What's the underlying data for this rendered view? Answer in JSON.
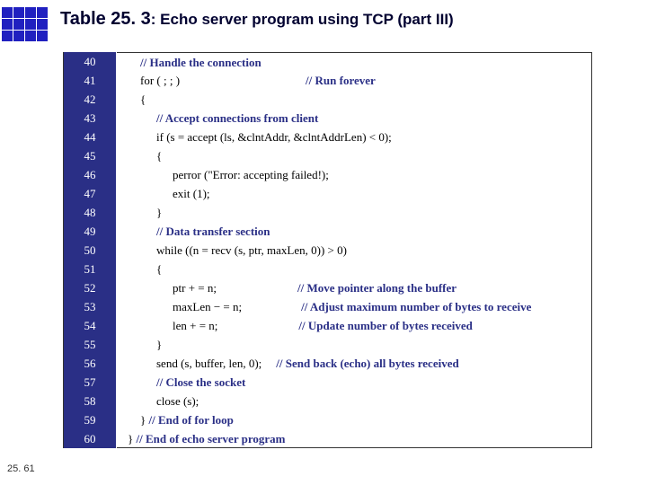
{
  "title": {
    "main": "Table 25. 3",
    "sub": ": Echo server program using TCP (part III)"
  },
  "slideNumber": "25. 61",
  "rows": [
    {
      "n": "40",
      "indent": 18,
      "code": "",
      "comment": "// Handle the connection"
    },
    {
      "n": "41",
      "indent": 18,
      "code": "for ( ; ; )",
      "gap": 140,
      "comment": "// Run forever"
    },
    {
      "n": "42",
      "indent": 18,
      "code": "{",
      "comment": ""
    },
    {
      "n": "43",
      "indent": 36,
      "code": "",
      "comment": "// Accept connections from client"
    },
    {
      "n": "44",
      "indent": 36,
      "code": "if (s = accept (ls, &clntAddr, &clntAddrLen) < 0);",
      "comment": ""
    },
    {
      "n": "45",
      "indent": 36,
      "code": "{",
      "comment": ""
    },
    {
      "n": "46",
      "indent": 54,
      "code": "perror (\"Error: accepting failed!);",
      "comment": ""
    },
    {
      "n": "47",
      "indent": 54,
      "code": "exit (1);",
      "comment": ""
    },
    {
      "n": "48",
      "indent": 36,
      "code": "}",
      "comment": ""
    },
    {
      "n": "49",
      "indent": 36,
      "code": "",
      "comment": "// Data transfer section"
    },
    {
      "n": "50",
      "indent": 36,
      "code": "while ((n = recv (s, ptr, maxLen, 0)) > 0)",
      "comment": ""
    },
    {
      "n": "51",
      "indent": 36,
      "code": "{",
      "comment": ""
    },
    {
      "n": "52",
      "indent": 54,
      "code": "ptr + = n;",
      "gap": 90,
      "comment": "// Move pointer along the buffer"
    },
    {
      "n": "53",
      "indent": 54,
      "code": "maxLen − = n;",
      "gap": 66,
      "comment": "// Adjust maximum number of bytes to receive"
    },
    {
      "n": "54",
      "indent": 54,
      "code": "len + = n;",
      "gap": 90,
      "comment": "// Update number of bytes received"
    },
    {
      "n": "55",
      "indent": 36,
      "code": "}",
      "comment": ""
    },
    {
      "n": "56",
      "indent": 36,
      "code": "send (s, buffer, len, 0);",
      "gap": 16,
      "comment": "// Send back (echo) all bytes received"
    },
    {
      "n": "57",
      "indent": 36,
      "code": "",
      "comment": "// Close the socket"
    },
    {
      "n": "58",
      "indent": 36,
      "code": "close (s);",
      "comment": ""
    },
    {
      "n": "59",
      "indent": 18,
      "code": "} ",
      "comment": "// End of for loop"
    },
    {
      "n": "60",
      "indent": 4,
      "code": "} ",
      "comment": "// End of echo server program"
    }
  ]
}
